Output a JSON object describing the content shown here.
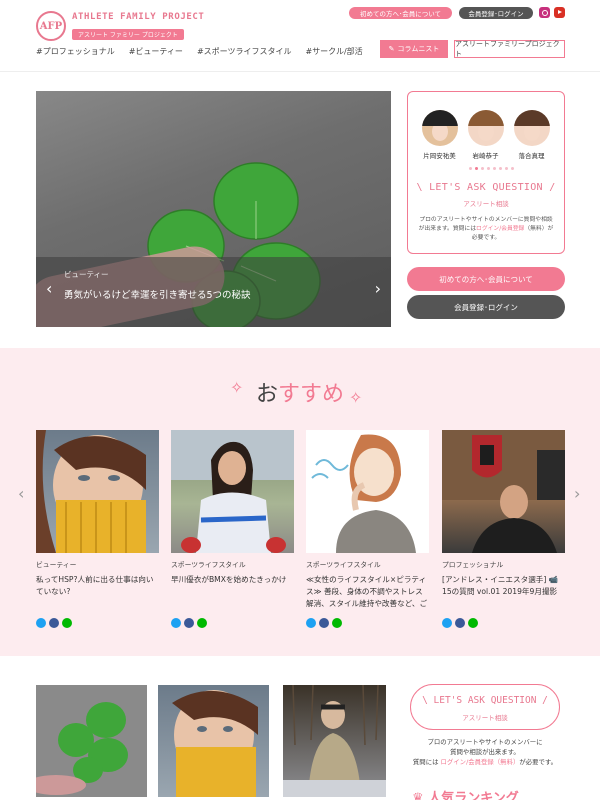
{
  "header": {
    "logo_mark": "AFP",
    "logo_title": "ATHLETE FAMILY PROJECT",
    "logo_sub": "アスリート ファミリー プロジェクト",
    "first_time_label": "初めての方へ･会員について",
    "login_label": "会員登録･ログイン",
    "nav": [
      "#プロフェッショナル",
      "#ビューティー",
      "#スポーツライフスタイル",
      "#サークル/部活"
    ],
    "columnist_label": "コラムニスト",
    "afp_label": "アスリートファミリープロジェクト"
  },
  "hero": {
    "category": "ビューティー",
    "title": "勇気がいるけど幸運を引き寄せる5つの秘訣"
  },
  "ask_panel": {
    "athletes": [
      {
        "name": "片岡安祐美"
      },
      {
        "name": "岩崎恭子"
      },
      {
        "name": "落合真理"
      }
    ],
    "heading": "\\ LET'S ASK QUESTION /",
    "sub": "アスリート相談",
    "desc_pre": "プロのアスリートやサイトのメンバーに質問や相談が出来ます。質問には",
    "desc_link": "ログイン/会員登録",
    "desc_post": "（無料）が必要です。",
    "first_time_button": "初めての方へ･会員について",
    "login_button": "会員登録･ログイン"
  },
  "recommend": {
    "title_pre": "お",
    "title_pink": "すすめ",
    "cards": [
      {
        "category": "ビューティー",
        "title": "私ってHSP?人前に出る仕事は向いていない?"
      },
      {
        "category": "スポーツライフスタイル",
        "title": "早川優衣がBMXを始めたきっかけ"
      },
      {
        "category": "スポーツライフスタイル",
        "title": "≪女性のライフスタイル×ピラティス≫ 善段、身体の不調やストレス解消、スタイル維持や改善など、ご自身の身体…"
      },
      {
        "category": "プロフェッショナル",
        "title": "[アンドレス・イニエスタ選手] 📹15の質問 vol.01 2019年9月撮影"
      }
    ]
  },
  "bottom": {
    "ask_heading": "\\ LET'S ASK QUESTION /",
    "ask_sub": "アスリート相談",
    "desc_line1": "プロのアスリートやサイトのメンバーに",
    "desc_line2": "質問や相談が出来ます。",
    "desc_line3_pre": "質問には ",
    "desc_link": "ログイン/会員登録（無料）",
    "desc_line3_post": "が必要です。",
    "ranking_label": "人気ランキング"
  },
  "colors": {
    "accent": "#f27a92",
    "dark_button": "#555555",
    "section_bg": "#fdecef"
  }
}
